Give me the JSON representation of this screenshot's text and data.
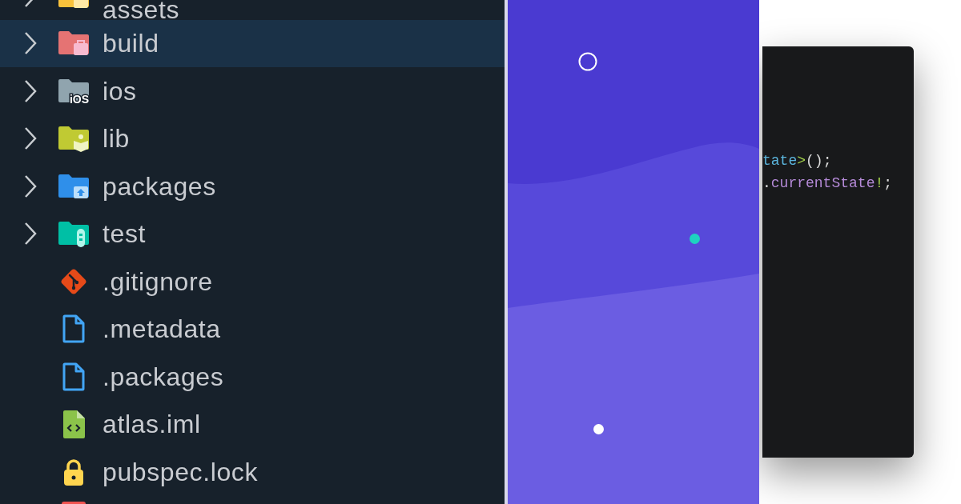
{
  "explorer": {
    "items": [
      {
        "kind": "assets",
        "name": "assets",
        "expanded": false,
        "selected": false
      },
      {
        "kind": "build",
        "name": "build",
        "expanded": false,
        "selected": true
      },
      {
        "kind": "ios",
        "name": "ios",
        "badge": "iOS",
        "expanded": false,
        "selected": false
      },
      {
        "kind": "lib",
        "name": "lib",
        "expanded": false,
        "selected": false
      },
      {
        "kind": "packages",
        "name": "packages",
        "expanded": false,
        "selected": false
      },
      {
        "kind": "test",
        "name": "test",
        "expanded": false,
        "selected": false
      },
      {
        "kind": "git",
        "name": ".gitignore",
        "selected": false
      },
      {
        "kind": "document",
        "name": ".metadata",
        "selected": false
      },
      {
        "kind": "document",
        "name": ".packages",
        "selected": false
      },
      {
        "kind": "code",
        "name": "atlas.iml",
        "selected": false
      },
      {
        "kind": "lock",
        "name": "pubspec.lock",
        "selected": false
      },
      {
        "kind": "clipped",
        "selected": false
      }
    ]
  },
  "code_card": {
    "lines": [
      {
        "tokens": [
          {
            "kind": "type",
            "text": "tate"
          },
          {
            "kind": "operator",
            "text": ">"
          },
          {
            "kind": "plain",
            "text": "();"
          }
        ]
      },
      {
        "tokens": [
          {
            "kind": "plain",
            "text": "."
          },
          {
            "kind": "property",
            "text": "currentState"
          },
          {
            "kind": "operator",
            "text": "!"
          },
          {
            "kind": "plain",
            "text": ";"
          }
        ]
      }
    ]
  }
}
